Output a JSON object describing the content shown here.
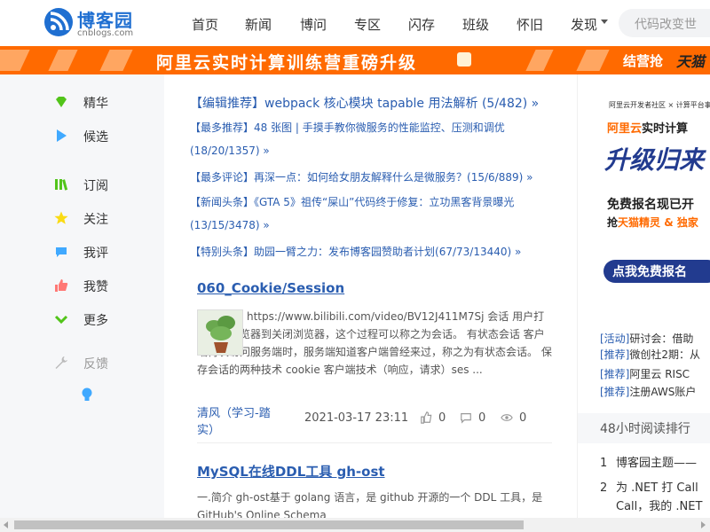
{
  "header": {
    "logo_name": "博客园",
    "logo_sub": "cnblogs.com",
    "nav": [
      "首页",
      "新闻",
      "博问",
      "专区",
      "闪存",
      "班级",
      "怀旧",
      "发现"
    ],
    "search_placeholder": "代码改变世"
  },
  "banner": {
    "text": "阿里云实时计算训练营重磅升级",
    "sub": "结营抢",
    "sub2": "天猫"
  },
  "sidebar": {
    "items": [
      {
        "label": "精华",
        "icon": "gem-icon",
        "color": "#52c41a"
      },
      {
        "label": "候选",
        "icon": "play-icon",
        "color": "#40a9ff"
      },
      {
        "label": "订阅",
        "icon": "books-icon",
        "color": "#52c41a"
      },
      {
        "label": "关注",
        "icon": "star-icon",
        "color": "#fadb14"
      },
      {
        "label": "我评",
        "icon": "comment-icon",
        "color": "#40a9ff"
      },
      {
        "label": "我赞",
        "icon": "thumb-up-icon",
        "color": "#ff7875"
      },
      {
        "label": "更多",
        "icon": "chevron-down-icon",
        "color": "#52c41a"
      },
      {
        "label": "反馈",
        "icon": "wrench-icon",
        "color": "#bbbbbb"
      },
      {
        "label": "",
        "icon": "lightbulb-icon",
        "color": "#40a9ff"
      }
    ]
  },
  "headlines": [
    {
      "tag": "【编辑推荐】",
      "text": "webpack 核心模块 tapable 用法解析 (5/482) »"
    },
    {
      "tag": "【最多推荐】",
      "text": "48 张图 | 手摸手教你微服务的性能监控、压测和调优"
    },
    {
      "tag": "",
      "text": "(18/20/1357) »"
    },
    {
      "tag": "【最多评论】",
      "text": "再深一点：如何给女朋友解释什么是微服务？(15/6/889) »"
    },
    {
      "tag": "【新闻头条】",
      "text": "《GTA 5》祖传“屎山”代码终于修复：立功黑客背景曝光"
    },
    {
      "tag": "",
      "text": "(13/15/3478) »"
    },
    {
      "tag": "【特别头条】",
      "text": "助园一臂之力：发布博客园赞助者计划(67/73/13440) »"
    }
  ],
  "posts": [
    {
      "title": "060_Cookie/Session",
      "summary": "https://www.bilibili.com/video/BV12J411M7Sj 会话 用户打开一个浏览器到关闭浏览器，这个过程可以称之为会话。 有状态会话 客户端再次访问服务端时，服务端知道客户端曾经来过，称之为有状态会话。 保存会话的两种技术 cookie 客户端技术（响应，请求）ses ...",
      "author": "清风（学习-踏实）",
      "date": "2021-03-17 23:11",
      "likes": "0",
      "comments": "0",
      "views": "0"
    },
    {
      "title": "MySQL在线DDL工具 gh-ost",
      "summary": "一.简介 gh-ost基于 golang 语言，是 github 开源的一个 DDL 工具，是 GitHub's Online Schema"
    }
  ],
  "right": {
    "ad": {
      "small": "阿里云开发者社区 × 计算平台事业",
      "title_hot": "阿里云",
      "title": "实时计算",
      "big": "升级归来",
      "free": "免费报名现已开",
      "grab": "抢",
      "grab_hot": "天猫精灵 & 独家",
      "button": "点我免费报名"
    },
    "promos": [
      {
        "tag": "[活动]",
        "text": "研讨会：借助"
      },
      {
        "tag": "[推荐]",
        "text": "微创社2期：从"
      },
      {
        "tag": "[推荐]",
        "text": "阿里云 RISC"
      },
      {
        "tag": "[推荐]",
        "text": "注册AWS账户"
      }
    ],
    "rank_title": "48小时阅读排行",
    "rank": [
      {
        "no": "1",
        "text": "博客园主题——"
      },
      {
        "no": "2",
        "text": "为 .NET 打 Call"
      },
      {
        "no": "",
        "text": "Call，我的 .NET"
      }
    ]
  },
  "colors": {
    "brand": "#1f6fd1",
    "banner": "#ff6a00",
    "link": "#2a5db0"
  }
}
